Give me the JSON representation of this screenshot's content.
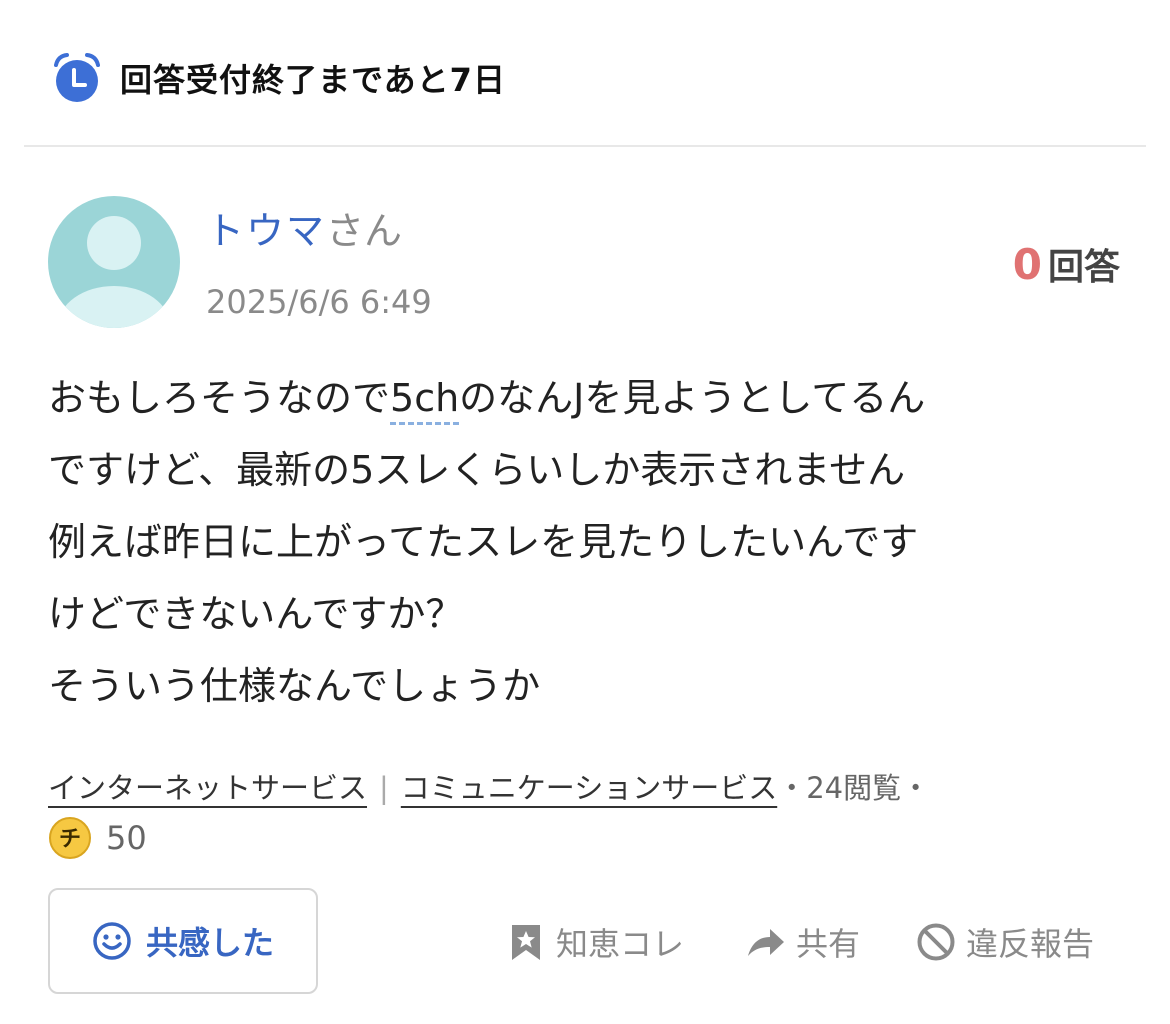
{
  "deadline": {
    "icon": "alarm-clock-icon",
    "text": "回答受付終了まであと7日"
  },
  "question": {
    "author": {
      "name": "トウマ",
      "suffix": "さん",
      "posted_at": "2025/6/6 6:49"
    },
    "answer_count": {
      "value": "0",
      "label": "回答"
    },
    "body": {
      "line1_pre": "おもしろそうなので",
      "line1_keyword": "5ch",
      "line1_post": "のなんJを見ようとしてるん",
      "line2": "ですけど、最新の5スレくらいしか表示されません",
      "line3": "例えば昨日に上がってたスレを見たりしたいんです",
      "line4": "けどできないんですか？",
      "line5": "そういう仕様なんでしょうか"
    },
    "categories": [
      "インターネットサービス",
      "コミュニケーションサービス"
    ],
    "category_separator": "|",
    "views": "・24閲覧・",
    "coins": {
      "icon_text": "チ",
      "value": "50"
    }
  },
  "actions": {
    "empathy_label": "共感した",
    "save_label": "知恵コレ",
    "share_label": "共有",
    "report_label": "違反報告"
  },
  "colors": {
    "accent": "#3866c2",
    "answer_count": "#e07272",
    "alarm": "#3d6fd6",
    "coin": "#f6c842"
  }
}
